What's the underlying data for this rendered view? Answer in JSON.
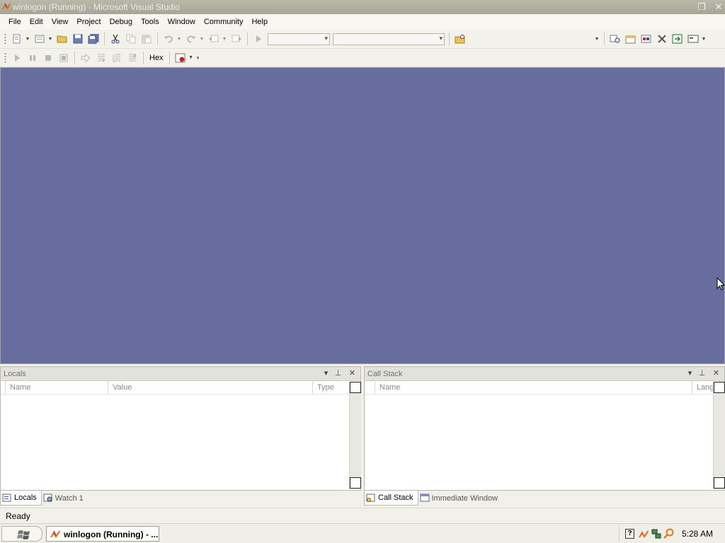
{
  "window": {
    "title": "winlogon (Running) - Microsoft Visual Studio",
    "restore_glyph": "❐",
    "close_glyph": "✕"
  },
  "menu": {
    "items": [
      "File",
      "Edit",
      "View",
      "Project",
      "Debug",
      "Tools",
      "Window",
      "Community",
      "Help"
    ]
  },
  "toolbar2": {
    "hex_label": "Hex"
  },
  "panels": {
    "locals": {
      "title": "Locals",
      "columns": [
        "Name",
        "Value",
        "Type"
      ]
    },
    "callstack": {
      "title": "Call Stack",
      "columns": [
        "Name",
        "Lang"
      ]
    }
  },
  "tabs_left": [
    "Locals",
    "Watch 1"
  ],
  "tabs_right": [
    "Call Stack",
    "Immediate Window"
  ],
  "status": {
    "text": "Ready"
  },
  "taskbar": {
    "task_label": "winlogon (Running) - ...",
    "clock": "5:28 AM",
    "help_glyph": "?"
  },
  "icons": {
    "panel_dropdown": "▾",
    "panel_pin": "⊥",
    "panel_close": "✕"
  },
  "colors": {
    "editor_background": "#676d9f",
    "titlebar": "#b0b0a0"
  }
}
